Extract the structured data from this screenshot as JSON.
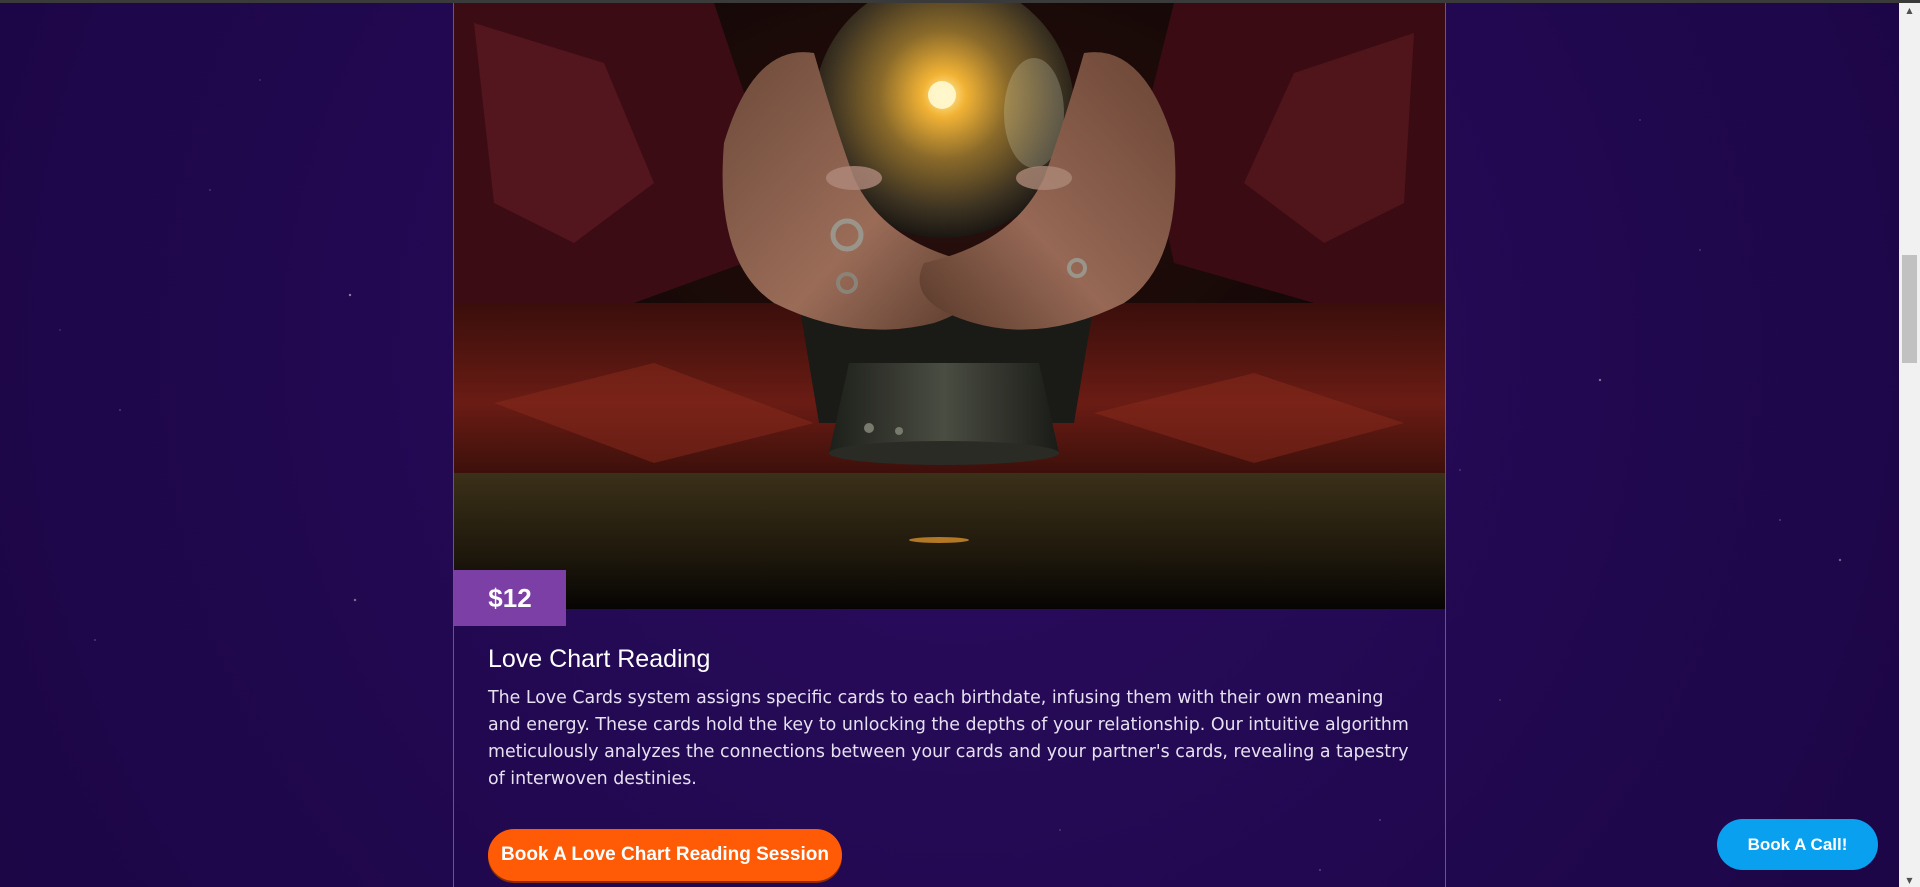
{
  "service": {
    "price": "$12",
    "title": "Love Chart Reading",
    "description": "The Love Cards system assigns specific cards to each birthdate, infusing them with their own meaning and energy. These cards hold the key to unlocking the depths of your relationship. Our intuitive algorithm meticulously analyzes the connections between your cards and your partner's cards, revealing a tapestry of interwoven destinies.",
    "image_alt": "Hands around a glowing crystal ball",
    "cta_label": "Book A Love Chart Reading Session"
  },
  "floating_cta": {
    "label": "Book A Call!"
  },
  "colors": {
    "page_background": "#21084f",
    "price_badge": "#7b3fa6",
    "session_button": "#ff5a05",
    "call_button": "#0aa0f0"
  },
  "icons": {
    "scroll_up": "triangle-up-icon",
    "scroll_down": "triangle-down-icon"
  }
}
